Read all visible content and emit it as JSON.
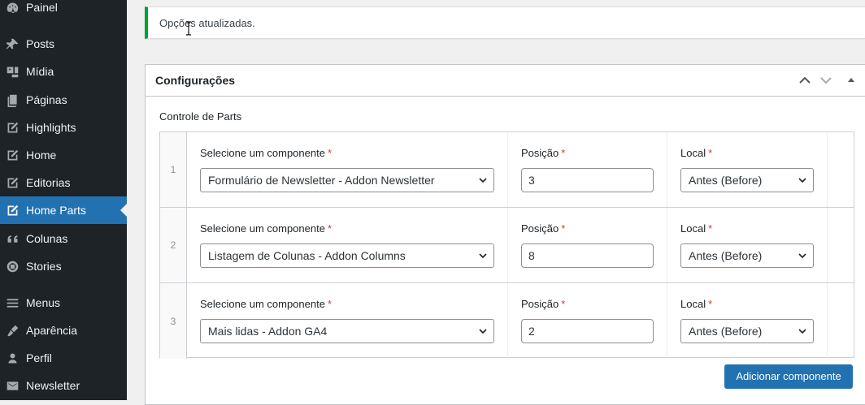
{
  "sidebar": {
    "items": [
      {
        "label": "Painel",
        "icon": "dashboard-icon"
      },
      {
        "label": "Posts",
        "icon": "pin-icon"
      },
      {
        "label": "Mídia",
        "icon": "media-icon"
      },
      {
        "label": "Páginas",
        "icon": "pages-icon"
      },
      {
        "label": "Highlights",
        "icon": "edit-page-icon"
      },
      {
        "label": "Home",
        "icon": "edit-page-icon"
      },
      {
        "label": "Editorias",
        "icon": "edit-page-icon"
      },
      {
        "label": "Home Parts",
        "icon": "edit-page-icon",
        "active": true
      },
      {
        "label": "Colunas",
        "icon": "quote-icon"
      },
      {
        "label": "Stories",
        "icon": "stories-icon"
      },
      {
        "label": "Menus",
        "icon": "menu-icon"
      },
      {
        "label": "Aparência",
        "icon": "brush-icon"
      },
      {
        "label": "Perfil",
        "icon": "user-icon"
      },
      {
        "label": "Newsletter",
        "icon": "email-icon"
      }
    ]
  },
  "notice": {
    "text": "Opções atualizadas."
  },
  "postbox": {
    "title": "Configurações",
    "field_label": "Controle de Parts",
    "columns": {
      "component": "Selecione um componente",
      "position": "Posição",
      "local": "Local",
      "required_mark": "*"
    },
    "rows": [
      {
        "order": "1",
        "component": "Formulário de Newsletter - Addon Newsletter",
        "position": "3",
        "local": "Antes (Before)"
      },
      {
        "order": "2",
        "component": "Listagem de Colunas - Addon Columns",
        "position": "8",
        "local": "Antes (Before)"
      },
      {
        "order": "3",
        "component": "Mais lidas - Addon GA4",
        "position": "2",
        "local": "Antes (Before)"
      }
    ],
    "add_button": "Adicionar componente"
  },
  "colors": {
    "sidebar_bg": "#1d2327",
    "active_bg": "#2271b1",
    "notice_border": "#00a32a",
    "required": "#d63638",
    "primary_button": "#2271b1"
  }
}
